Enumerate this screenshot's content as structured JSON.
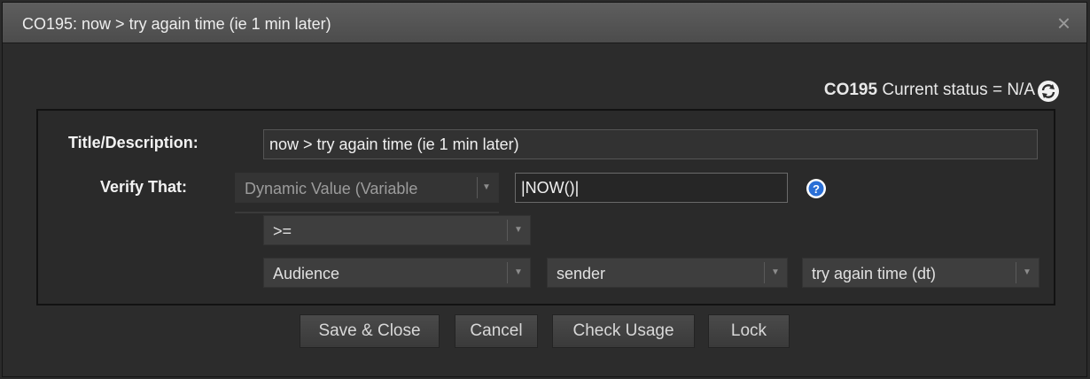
{
  "dialog": {
    "title": "CO195: now > try again time (ie 1 min later)",
    "close_glyph": "×"
  },
  "status": {
    "code": "CO195",
    "text": " Current status = N/A",
    "refresh_icon": "refresh-icon"
  },
  "form": {
    "title_label": "Title/Description:",
    "title_value": "now > try again time (ie 1 min later)",
    "verify_label": "Verify That:",
    "source_select": "Dynamic Value (Variable",
    "expression_value": "|NOW()|",
    "help_icon": "help-icon",
    "operator_select": ">=",
    "audience_select": "Audience",
    "sender_select": "sender",
    "field_select": "try again time (dt)"
  },
  "buttons": {
    "save_close": "Save & Close",
    "cancel": "Cancel",
    "check_usage": "Check Usage",
    "lock": "Lock"
  },
  "colors": {
    "background": "#2c2c2c",
    "titlebar": "#555555",
    "help_icon": "#2a6fd6"
  }
}
